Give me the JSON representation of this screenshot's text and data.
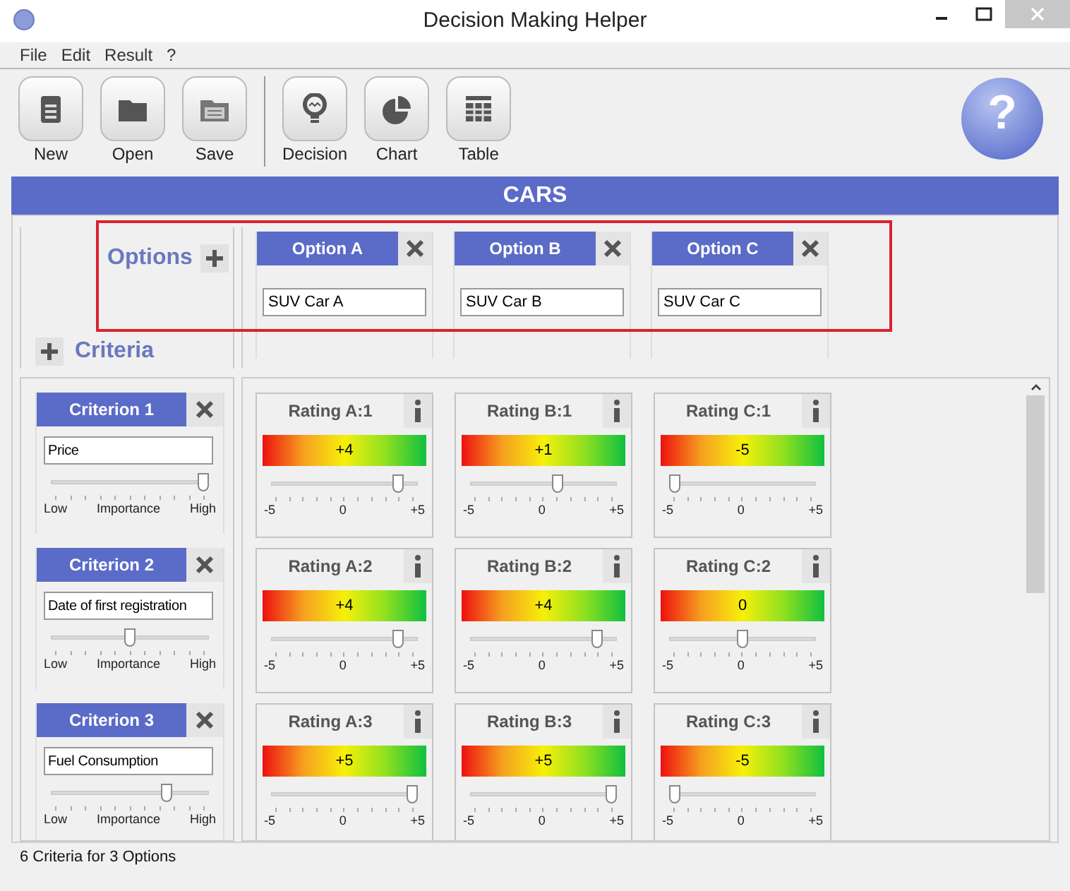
{
  "window": {
    "title": "Decision Making Helper"
  },
  "menu": [
    "File",
    "Edit",
    "Result",
    "?"
  ],
  "toolbar": [
    {
      "label": "New",
      "kind": "new"
    },
    {
      "label": "Open",
      "kind": "open"
    },
    {
      "label": "Save",
      "kind": "save"
    },
    {
      "label": "Decision",
      "kind": "decision"
    },
    {
      "label": "Chart",
      "kind": "chart"
    },
    {
      "label": "Table",
      "kind": "table"
    }
  ],
  "help_logo": {
    "mark": "?"
  },
  "banner": {
    "title": "CARS"
  },
  "options_header": {
    "label": "Options"
  },
  "criteria_header": {
    "label": "Criteria"
  },
  "options": [
    {
      "title": "Option A",
      "value": "SUV Car A"
    },
    {
      "title": "Option B",
      "value": "SUV Car B"
    },
    {
      "title": "Option C",
      "value": "SUV Car C"
    }
  ],
  "criteria": [
    {
      "title": "Criterion 1",
      "value": "Price",
      "level": 1,
      "low": "Low",
      "middle": "Importance",
      "high": "High"
    },
    {
      "title": "Criterion 2",
      "value": "Date of first registration",
      "level": 0.5,
      "low": "Low",
      "middle": "Importance",
      "high": "High"
    },
    {
      "title": "Criterion 3",
      "value": "Fuel Consumption",
      "level": 0.75,
      "low": "Low",
      "middle": "Importance",
      "high": "High"
    }
  ],
  "ratings": [
    [
      {
        "title": "Rating A:1",
        "reading": "+4",
        "level": 0.9,
        "min": "-5",
        "mid": "0",
        "max": "+5"
      },
      {
        "title": "Rating B:1",
        "reading": "+1",
        "level": 0.6,
        "min": "-5",
        "mid": "0",
        "max": "+5"
      },
      {
        "title": "Rating C:1",
        "reading": "-5",
        "level": 0,
        "min": "-5",
        "mid": "0",
        "max": "+5"
      }
    ],
    [
      {
        "title": "Rating A:2",
        "reading": "+4",
        "level": 0.9,
        "min": "-5",
        "mid": "0",
        "max": "+5"
      },
      {
        "title": "Rating B:2",
        "reading": "+4",
        "level": 0.9,
        "min": "-5",
        "mid": "0",
        "max": "+5"
      },
      {
        "title": "Rating C:2",
        "reading": "0",
        "level": 0.5,
        "min": "-5",
        "mid": "0",
        "max": "+5"
      }
    ],
    [
      {
        "title": "Rating A:3",
        "reading": "+5",
        "level": 1,
        "min": "-5",
        "mid": "0",
        "max": "+5"
      },
      {
        "title": "Rating B:3",
        "reading": "+5",
        "level": 1,
        "min": "-5",
        "mid": "0",
        "max": "+5"
      },
      {
        "title": "Rating C:3",
        "reading": "-5",
        "level": 0,
        "min": "-5",
        "mid": "0",
        "max": "+5"
      }
    ]
  ],
  "status_bar": "6 Criteria for 3 Options"
}
